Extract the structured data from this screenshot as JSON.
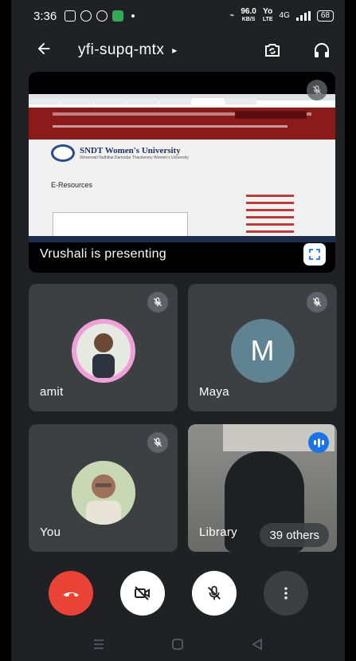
{
  "status_bar": {
    "time": "3:36",
    "net_speed": "96.0",
    "net_unit": "KB/S",
    "net_type_1": "Yo",
    "net_type_1b": "LTE",
    "net_type_2": "4G",
    "battery": "68"
  },
  "header": {
    "meeting_code": "yfi-supq-mtx",
    "caret": "▸",
    "back_icon": "arrow-left-icon",
    "switch_camera_icon": "switch-camera-icon",
    "audio_icon": "headphones-icon"
  },
  "presentation": {
    "label": "Vrushali is presenting",
    "site": {
      "university_name": "SNDT Women's University",
      "university_sub": "Shreemati Nathibai Damodar Thackersey Women's University",
      "page_heading": "E-Resources"
    }
  },
  "participants": [
    {
      "name": "amit",
      "muted": true,
      "avatar_type": "photo"
    },
    {
      "name": "Maya",
      "muted": true,
      "avatar_type": "initial",
      "initial": "M"
    },
    {
      "name": "You",
      "muted": true,
      "avatar_type": "photo"
    },
    {
      "name": "Library",
      "muted": false,
      "avatar_type": "video",
      "others_label": "39 others"
    }
  ],
  "controls": {
    "end_call_icon": "end-call-icon",
    "camera_icon": "camera-off-icon",
    "mic_icon": "mic-off-icon",
    "more_icon": "more-vert-icon"
  },
  "colors": {
    "background": "#202124",
    "tile": "#3c4043",
    "end_call": "#ea4335",
    "speaking": "#1a73e8"
  }
}
